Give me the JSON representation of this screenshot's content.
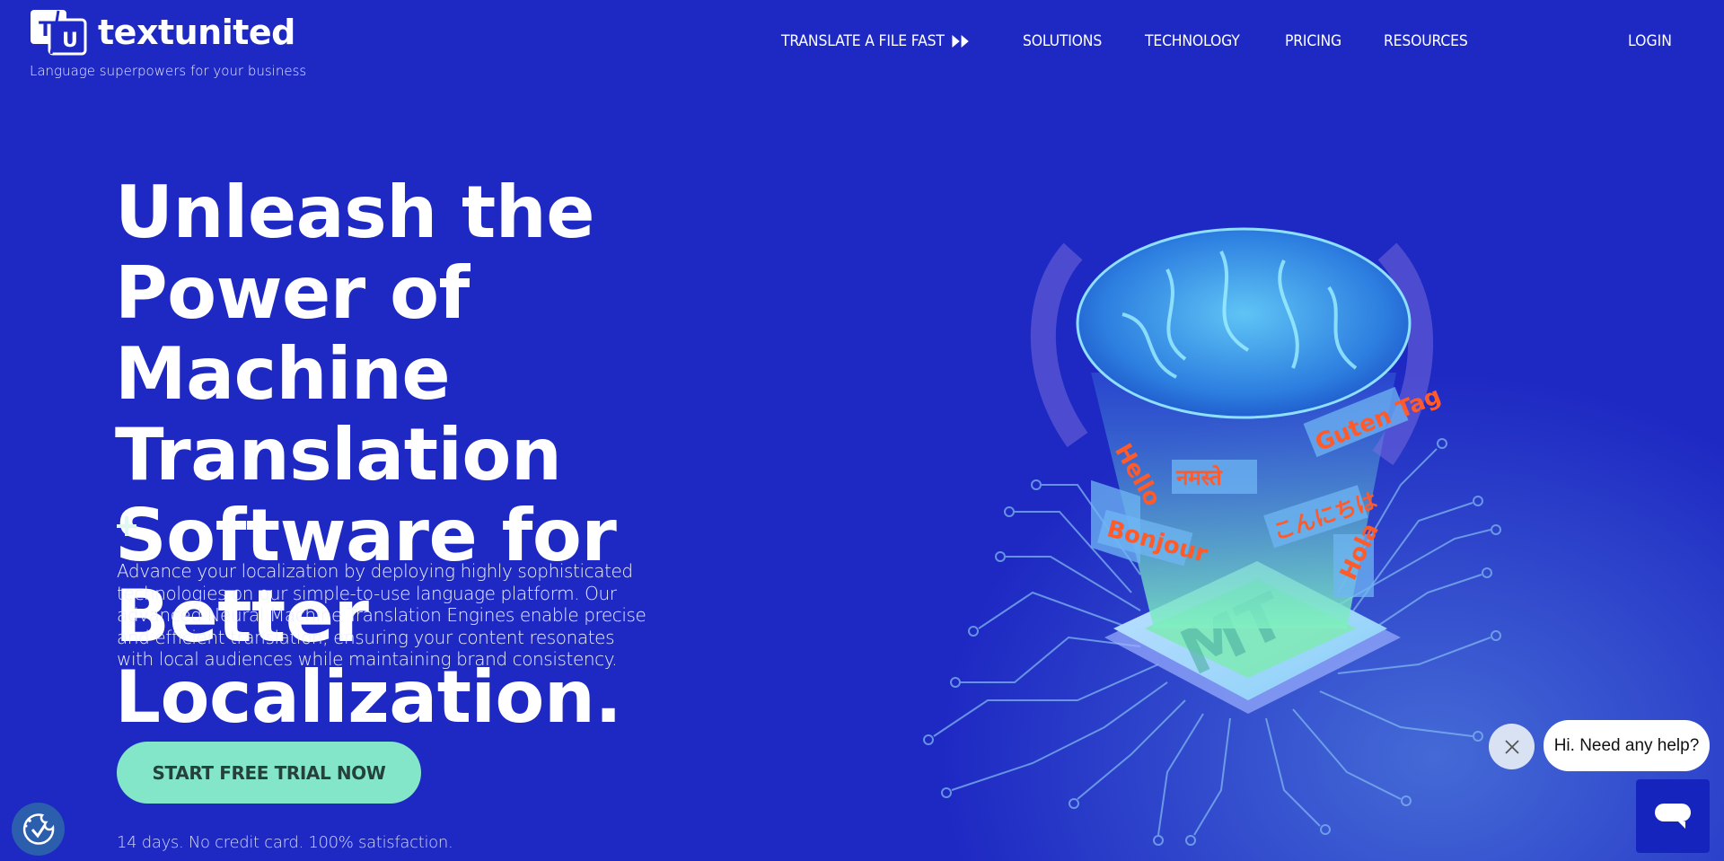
{
  "brand": {
    "name": "textunited",
    "tagline": "Language superpowers for your business",
    "logo_letters": [
      "T",
      "U"
    ]
  },
  "nav": {
    "items": [
      {
        "label": "TRANSLATE A FILE FAST",
        "icon": "double-play-icon"
      },
      {
        "label": "SOLUTIONS"
      },
      {
        "label": "TECHNOLOGY"
      },
      {
        "label": "PRICING"
      },
      {
        "label": "RESOURCES"
      }
    ],
    "login": "LOGIN"
  },
  "hero": {
    "title_lines": [
      "Unleash the Power of",
      "Machine Translation",
      "Software for Better",
      "Localization."
    ],
    "description": "Advance your localization by deploying highly sophisticated technologies on our simple-to-use language platform. Our advanced Neural Machine Translation Engines enable precise and efficient translation, ensuring your content resonates with local audiences while maintaining brand consistency.",
    "cta_label": "START FREE TRIAL NOW",
    "fine_print": "14 days. No credit card. 100% satisfaction."
  },
  "illustration": {
    "chip_label": "MT",
    "greetings": [
      "Hello",
      "नमस्ते",
      "Guten Tag",
      "Bonjour",
      "こんにちは",
      "Hola"
    ]
  },
  "chat": {
    "greeting": "Hi. Need any help?"
  },
  "colors": {
    "background": "#1e29c3",
    "cta": "#84e6c8",
    "cta_text": "#26413c",
    "greeting_text": "#ff5a2a",
    "chat_launcher": "#1524bd",
    "cookie_badge": "#2b5fad"
  }
}
